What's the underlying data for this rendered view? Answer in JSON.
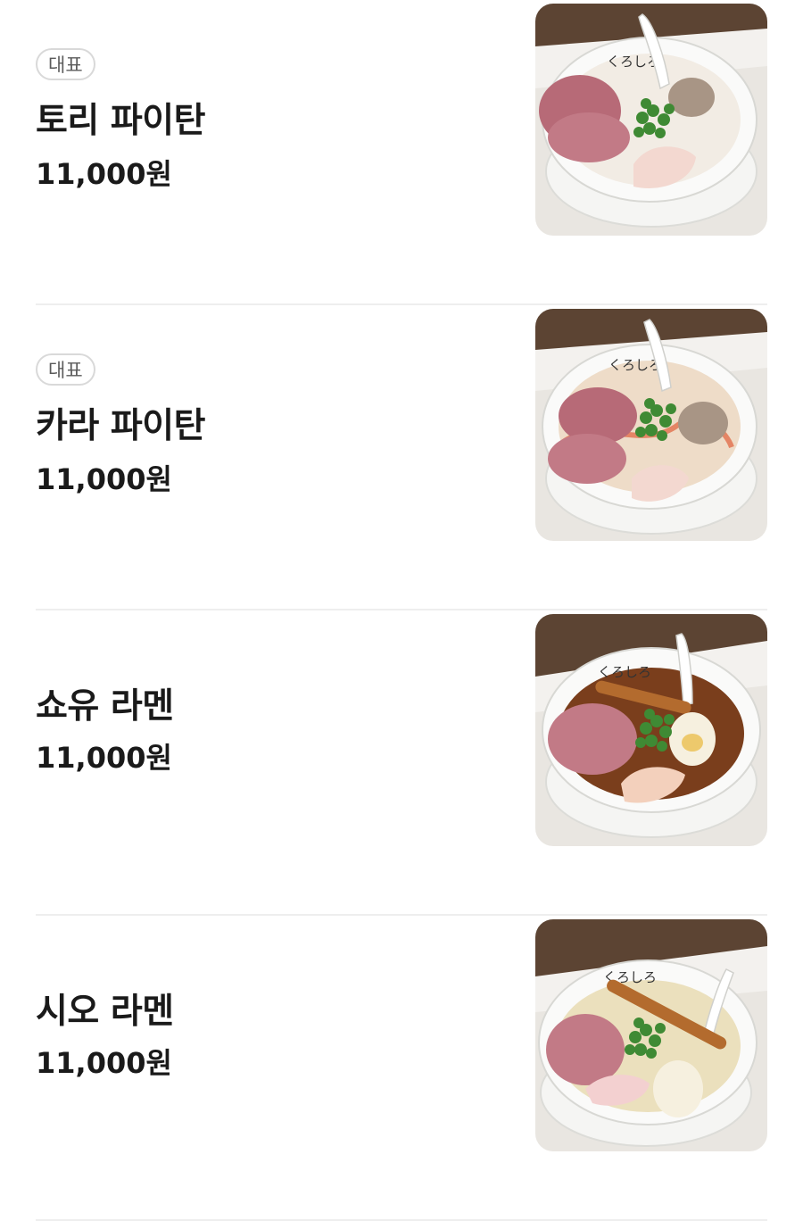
{
  "menu": {
    "items": [
      {
        "badge": "대표",
        "name": "토리 파이탄",
        "price": "11,000원",
        "photo": {
          "logo": "くろしろ",
          "broth": "#f2ece4",
          "wood": "#5c4433"
        }
      },
      {
        "badge": "대표",
        "name": "카라 파이탄",
        "price": "11,000원",
        "photo": {
          "logo": "くろしろ",
          "broth": "#eedcc8",
          "wood": "#5c4433"
        }
      },
      {
        "name": "쇼유 라멘",
        "price": "11,000원",
        "photo": {
          "logo": "くろしろ",
          "broth": "#7a3e1c",
          "wood": "#5c4433"
        }
      },
      {
        "name": "시오 라멘",
        "price": "11,000원",
        "photo": {
          "logo": "くろしろ",
          "broth": "#ebe0bd",
          "wood": "#5c4433"
        }
      }
    ]
  }
}
